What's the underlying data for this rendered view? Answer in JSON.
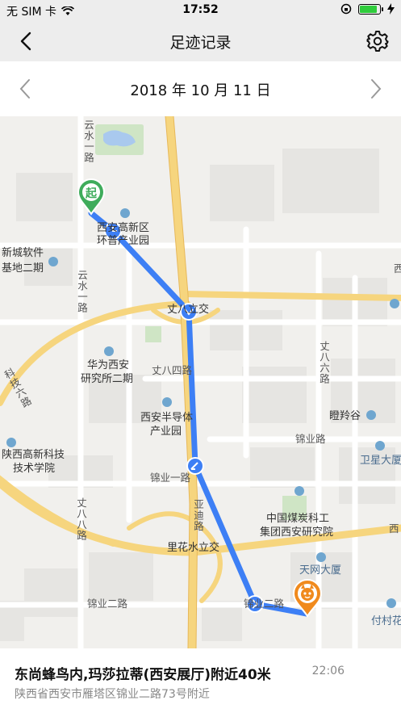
{
  "status_bar": {
    "carrier": "无 SIM 卡",
    "time": "17:52",
    "battery_level": 0.9
  },
  "header": {
    "title": "足迹记录"
  },
  "date_selector": {
    "date": "2018 年 10 月 11 日"
  },
  "map": {
    "start_marker_label": "起",
    "labels": {
      "yunshui_yilu_top": "云水一路",
      "xi_gaoxin": "西安高新区",
      "huanpu": "环普产业园",
      "xincheng_software": "新城软件",
      "base_2": "基地二期",
      "yunshui_yilu_mid": "云水一路",
      "zhangba_overpass": "丈八立交",
      "west_edge": "西",
      "huawei_1": "华为西安",
      "huawei_2": "研究所二期",
      "zhangba_silu": "丈八四路",
      "zhangba_liulu": "丈八六路",
      "keji_lu": "科技六路",
      "dengling_gu": "瞪羚谷",
      "xian_semi_1": "西安半导体",
      "xian_semi_2": "产业园",
      "jinye_lu_right": "锦业路",
      "weixing": "卫星大厦",
      "shaanxi_gaoxin_1": "陕西高新科技",
      "shaanxi_gaoxin_2": "技术学院",
      "jinye_yilu": "锦业一路",
      "zhangba_balu": "丈八八路",
      "yadi_lu": "亚迪路",
      "coal_1": "中国煤炭科工",
      "coal_2": "集团西安研究院",
      "xi_right": "西",
      "lihuashui": "里花水立交",
      "tianwang": "天网大厦",
      "jinye_erlu": "锦业二路",
      "jinye_erlu_2": "锦业二路",
      "fucun": "付村花"
    }
  },
  "footprint": {
    "place": "东尚蜂鸟内,玛莎拉蒂(西安展厅)附近40米",
    "time": "22:06",
    "address": "陕西省西安市雁塔区锦业二路73号附近"
  },
  "colors": {
    "route": "#3d7ff5",
    "start": "#3fac5b",
    "current": "#f08a1d"
  }
}
